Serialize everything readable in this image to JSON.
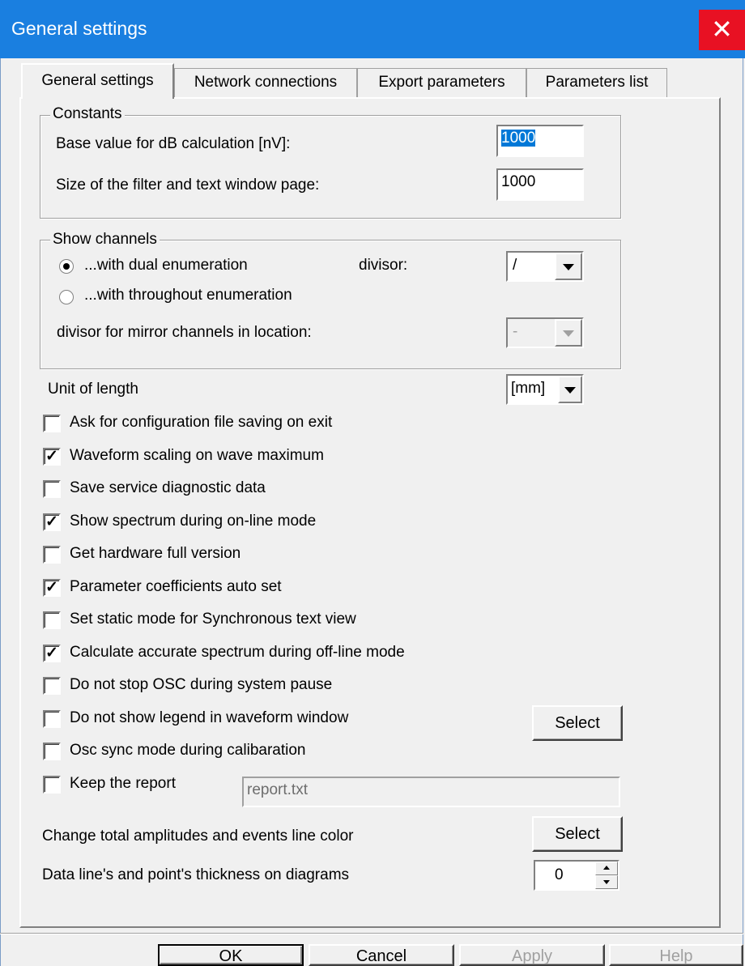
{
  "window": {
    "title": "General settings",
    "close_glyph": "✕"
  },
  "tabs": [
    "General settings",
    "Network connections",
    "Export parameters",
    "Parameters list"
  ],
  "constants": {
    "legend": "Constants",
    "db_label": "Base value for dB calculation [nV]:",
    "db_value": "1000",
    "page_label": "Size of the filter and text window page:",
    "page_value": "1000"
  },
  "show_channels": {
    "legend": "Show channels",
    "radio_dual": "...with dual enumeration",
    "radio_throughout": "...with throughout enumeration",
    "selected": "dual",
    "divisor_label": "divisor:",
    "divisor_value": "/",
    "mirror_label": "divisor for mirror channels in location:",
    "mirror_value": "-"
  },
  "unit": {
    "label": "Unit of length",
    "value": "[mm]"
  },
  "checkboxes": [
    {
      "label": "Ask for configuration file saving on exit",
      "checked": false
    },
    {
      "label": "Waveform scaling on wave maximum",
      "checked": true
    },
    {
      "label": "Save service diagnostic data",
      "checked": false
    },
    {
      "label": "Show spectrum during on-line mode",
      "checked": true
    },
    {
      "label": "Get hardware full version",
      "checked": false
    },
    {
      "label": "Parameter coefficients auto set",
      "checked": true
    },
    {
      "label": "Set static mode for Synchronous text view",
      "checked": false
    },
    {
      "label": "Calculate accurate spectrum during off-line mode",
      "checked": true
    },
    {
      "label": "Do not stop OSC during system pause",
      "checked": false
    },
    {
      "label": "Do not show legend in waveform window",
      "checked": false
    },
    {
      "label": "Osc sync mode during calibaration",
      "checked": false
    },
    {
      "label": "Keep the report",
      "checked": false
    }
  ],
  "legend_select_label": "Select",
  "report_file": "report.txt",
  "line_color": {
    "label": "Change total amplitudes and events line color",
    "button": "Select"
  },
  "thickness": {
    "label": "Data line's and point's thickness on diagrams",
    "value": "0"
  },
  "buttons": {
    "ok": "OK",
    "cancel": "Cancel",
    "apply": "Apply",
    "help": "Help"
  }
}
